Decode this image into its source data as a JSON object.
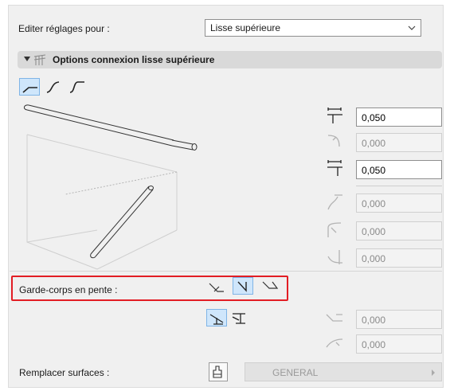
{
  "edit_settings": {
    "label": "Editer réglages pour :",
    "selected": "Lisse supérieure"
  },
  "section": {
    "title": "Options connexion lisse supérieure"
  },
  "connection_types": [
    {
      "icon": "straight-end-icon",
      "selected": true
    },
    {
      "icon": "curved-end-icon",
      "selected": false
    },
    {
      "icon": "s-curve-end-icon",
      "selected": false
    }
  ],
  "fields": [
    {
      "icon": "horizontal-offset-icon",
      "value": "0,050",
      "enabled": true
    },
    {
      "icon": "corner-radius-icon",
      "value": "0,000",
      "enabled": false
    },
    {
      "icon": "horizontal-extension-icon",
      "value": "0,050",
      "enabled": true
    },
    {
      "icon": "curve-offset-icon",
      "value": "0,000",
      "enabled": false
    },
    {
      "icon": "curve-radius-icon",
      "value": "0,000",
      "enabled": false
    },
    {
      "icon": "bottom-curve-icon",
      "value": "0,000",
      "enabled": false
    },
    {
      "icon": "slope-offset-icon",
      "value": "0,000",
      "enabled": false
    },
    {
      "icon": "slope-radius-icon",
      "value": "0,000",
      "enabled": false
    }
  ],
  "slope": {
    "label": "Garde-corps en pente :",
    "options": [
      {
        "icon": "slope-horizontal-icon",
        "selected": false
      },
      {
        "icon": "slope-vertical-icon",
        "selected": true
      },
      {
        "icon": "slope-angled-icon",
        "selected": false
      }
    ],
    "sub_options": [
      {
        "icon": "stair-step-left-icon",
        "selected": true
      },
      {
        "icon": "stair-step-right-icon",
        "selected": false
      }
    ]
  },
  "override": {
    "label": "Remplacer surfaces :",
    "surface": "GENERAL"
  }
}
